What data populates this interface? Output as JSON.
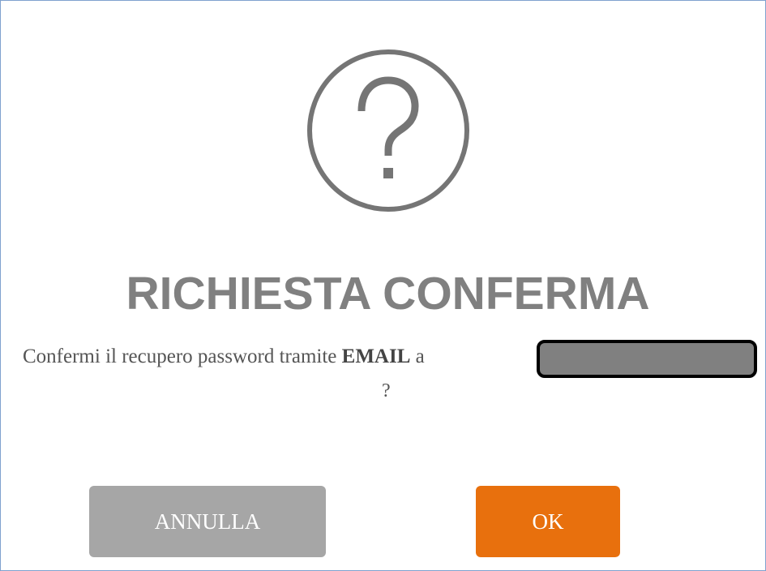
{
  "dialog": {
    "icon": "question-circle-icon",
    "title": "RICHIESTA CONFERMA",
    "message": {
      "prefix": "Confermi il recupero password tramite ",
      "emphasis": "EMAIL",
      "suffix": " a",
      "line2": "?"
    },
    "buttons": {
      "cancel_label": "ANNULLA",
      "ok_label": "OK"
    }
  },
  "colors": {
    "title": "#808080",
    "icon": "#757575",
    "cancel_button": "#a6a6a6",
    "ok_button": "#e8700d",
    "redaction_fill": "#808080",
    "redaction_border": "#000000"
  }
}
